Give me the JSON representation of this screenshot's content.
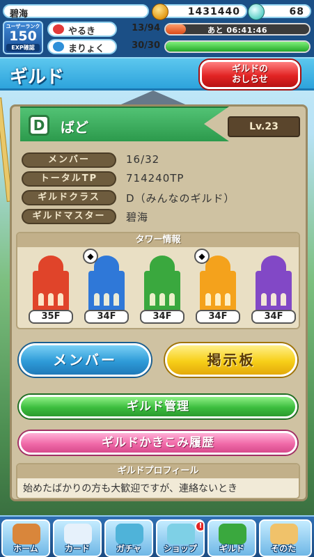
{
  "user": {
    "name": "碧海",
    "coins": "1431440",
    "gems": "68",
    "rank_title": "ユーザーランク",
    "rank": "150",
    "exp_label": "EXP確認"
  },
  "stats": {
    "yaruki": {
      "label": "やるき",
      "current": "13",
      "max": "94",
      "timer": "あと 06:41:46",
      "fill_fraction": 0.14
    },
    "maryoku": {
      "label": "まりょく",
      "current": "30",
      "max": "30",
      "fill_fraction": 1.0
    }
  },
  "header": {
    "title": "ギルド",
    "notice_line1": "ギルドの",
    "notice_line2": "おしらせ"
  },
  "guild": {
    "class_letter": "D",
    "name": "ばど",
    "level": "Lv.23",
    "rows": [
      {
        "label": "メンバー",
        "value": "16/32"
      },
      {
        "label": "トータルTP",
        "value": "714240TP"
      },
      {
        "label": "ギルドクラス",
        "value": "D（みんなのギルド）"
      },
      {
        "label": "ギルドマスター",
        "value": "碧海"
      }
    ]
  },
  "towers": {
    "header": "タワー情報",
    "items": [
      {
        "color": "#e0442a",
        "floor": "35F",
        "badge": ""
      },
      {
        "color": "#2f78d8",
        "floor": "34F",
        "badge": "◆"
      },
      {
        "color": "#3aa83e",
        "floor": "34F",
        "badge": ""
      },
      {
        "color": "#f4a21c",
        "floor": "34F",
        "badge": "◆"
      },
      {
        "color": "#8248c6",
        "floor": "34F",
        "badge": ""
      }
    ]
  },
  "buttons": {
    "member": "メンバー",
    "board": "掲示板",
    "manage": "ギルド管理",
    "history": "ギルドかきこみ履歴"
  },
  "profile": {
    "header": "ギルドプロフィール",
    "text": "始めたばかりの方も大歓迎ですが、連絡ないとき"
  },
  "nav": {
    "home": "ホーム",
    "card": "カード",
    "gacha": "ガチャ",
    "shop": "ショップ",
    "shop_alert": "!",
    "guild": "ギルド",
    "other": "そのた"
  }
}
